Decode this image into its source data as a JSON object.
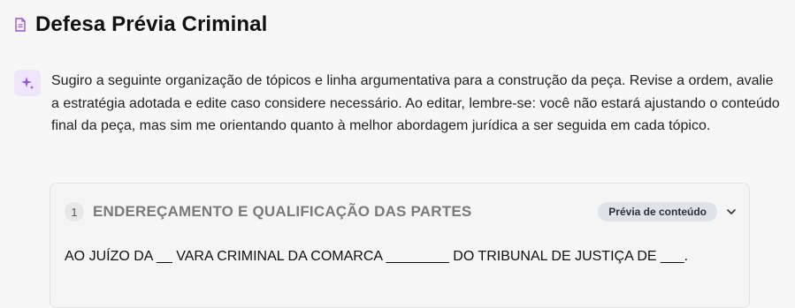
{
  "header": {
    "title": "Defesa Prévia Criminal",
    "icon": "document-icon"
  },
  "assistant": {
    "icon": "sparkle-icon",
    "message": "Sugiro a seguinte organização de tópicos e linha argumentativa para a construção da peça. Revise a ordem, avalie a estratégia adotada e edite caso considere necessário. Ao editar, lembre-se: você não estará ajustando o conteúdo final da peça, mas sim me orientando quanto à melhor abordagem jurídica a ser seguida em cada tópico."
  },
  "topics": [
    {
      "number": "1",
      "title": "ENDEREÇAMENTO E QUALIFICAÇÃO DAS PARTES",
      "badge": "Prévia de conteúdo",
      "content": "AO JUÍZO DA __ VARA CRIMINAL DA COMARCA ________ DO TRIBUNAL DE JUSTIÇA DE ___."
    }
  ],
  "colors": {
    "accent": "#9b51e0",
    "sparkle_bg": "#efe6fb",
    "badge_bg": "#dee2ea"
  }
}
